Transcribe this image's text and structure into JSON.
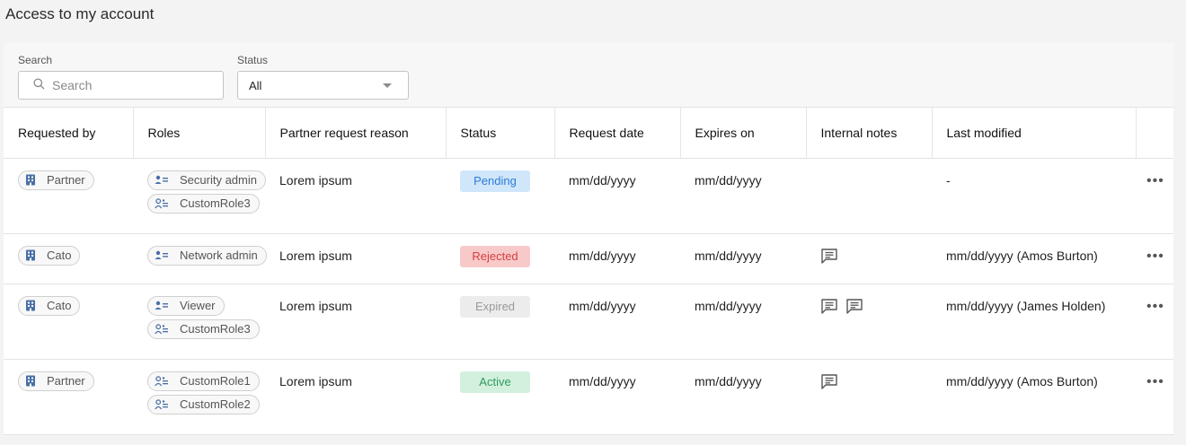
{
  "page": {
    "title": "Access to my account"
  },
  "filters": {
    "search_label": "Search",
    "search_placeholder": "Search",
    "status_label": "Status",
    "status_value": "All"
  },
  "table": {
    "columns": [
      "Requested by",
      "Roles",
      "Partner request reason",
      "Status",
      "Request date",
      "Expires on",
      "Internal notes",
      "Last modified"
    ],
    "rows": [
      {
        "requested_by": "Partner",
        "roles": [
          {
            "label": "Security admin",
            "icon": "user-role-icon"
          },
          {
            "label": "CustomRole3",
            "icon": "custom-role-icon"
          }
        ],
        "reason": "Lorem ipsum",
        "status": "Pending",
        "request_date": "mm/dd/yyyy",
        "expires_on": "mm/dd/yyyy",
        "notes_count": 0,
        "last_modified": "-"
      },
      {
        "requested_by": "Cato",
        "roles": [
          {
            "label": "Network admin",
            "icon": "user-role-icon"
          }
        ],
        "reason": "Lorem ipsum",
        "status": "Rejected",
        "request_date": "mm/dd/yyyy",
        "expires_on": "mm/dd/yyyy",
        "notes_count": 1,
        "last_modified": "mm/dd/yyyy (Amos Burton)"
      },
      {
        "requested_by": "Cato",
        "roles": [
          {
            "label": "Viewer",
            "icon": "user-role-icon"
          },
          {
            "label": "CustomRole3",
            "icon": "custom-role-icon"
          }
        ],
        "reason": "Lorem ipsum",
        "status": "Expired",
        "request_date": "mm/dd/yyyy",
        "expires_on": "mm/dd/yyyy",
        "notes_count": 2,
        "last_modified": "mm/dd/yyyy (James Holden)"
      },
      {
        "requested_by": "Partner",
        "roles": [
          {
            "label": "CustomRole1",
            "icon": "custom-role-icon"
          },
          {
            "label": "CustomRole2",
            "icon": "custom-role-icon"
          }
        ],
        "reason": "Lorem ipsum",
        "status": "Active",
        "request_date": "mm/dd/yyyy",
        "expires_on": "mm/dd/yyyy",
        "notes_count": 1,
        "last_modified": "mm/dd/yyyy (Amos Burton)"
      }
    ],
    "row_actions_label": "•••"
  },
  "status_colors": {
    "Pending": {
      "bg": "#cfe6fb",
      "fg": "#2e7bd6"
    },
    "Rejected": {
      "bg": "#f8c9c9",
      "fg": "#d64040"
    },
    "Expired": {
      "bg": "#ececec",
      "fg": "#9a9a9a"
    },
    "Active": {
      "bg": "#d3f0df",
      "fg": "#2f9a5c"
    }
  },
  "icons": {
    "building": "building-icon",
    "note": "note-icon",
    "search": "search-icon",
    "dropdown": "chevron-down-icon",
    "row_actions": "more-icon"
  }
}
